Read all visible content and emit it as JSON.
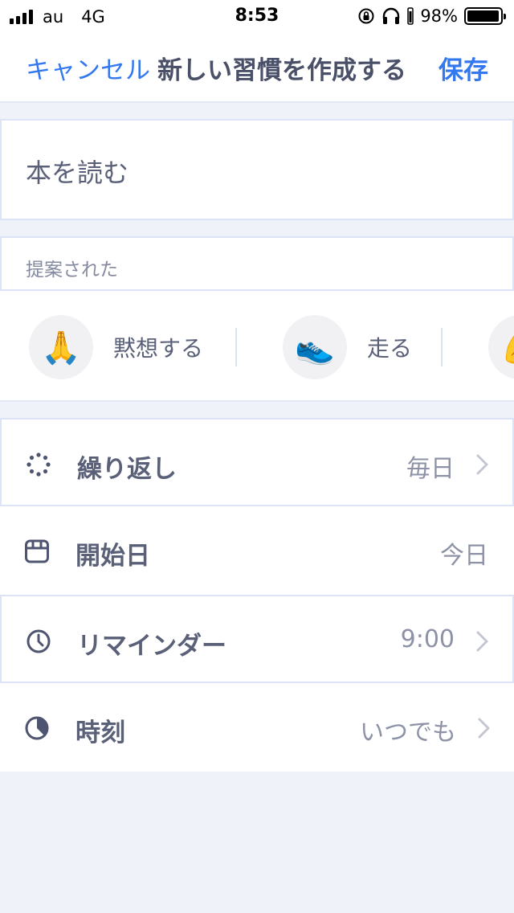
{
  "status_bar": {
    "carrier": "au",
    "network": "4G",
    "time": "8:53",
    "battery_percent": "98%",
    "battery_level": 0.98,
    "icons": [
      "signal-icon",
      "orientation-lock-icon",
      "headphones-icon",
      "battery-icon"
    ]
  },
  "nav": {
    "cancel": "キャンセル",
    "title": "新しい習慣を作成する",
    "save": "保存"
  },
  "habit_name": {
    "value": "本を読む"
  },
  "suggestions": {
    "header": "提案された",
    "items": [
      {
        "emoji": "🙏",
        "label": "黙想する"
      },
      {
        "emoji": "👟",
        "label": "走る"
      },
      {
        "emoji": "💪",
        "label": ""
      }
    ]
  },
  "settings": [
    {
      "label": "繰り返し",
      "value": "毎日",
      "icon": "repeat-icon",
      "chevron": true
    },
    {
      "label": "開始日",
      "value": "今日",
      "icon": "calendar-icon",
      "chevron": false
    },
    {
      "label": "リマインダー",
      "value": "9:00",
      "icon": "alarm-icon",
      "chevron": true
    },
    {
      "label": "時刻",
      "value": "いつでも",
      "icon": "clock-icon",
      "chevron": true
    }
  ],
  "colors": {
    "accent": "#3478f0",
    "text": "#5a6078",
    "secondary_text": "#8d92a6",
    "background": "#f0f2f9",
    "border": "#dde3f6"
  }
}
